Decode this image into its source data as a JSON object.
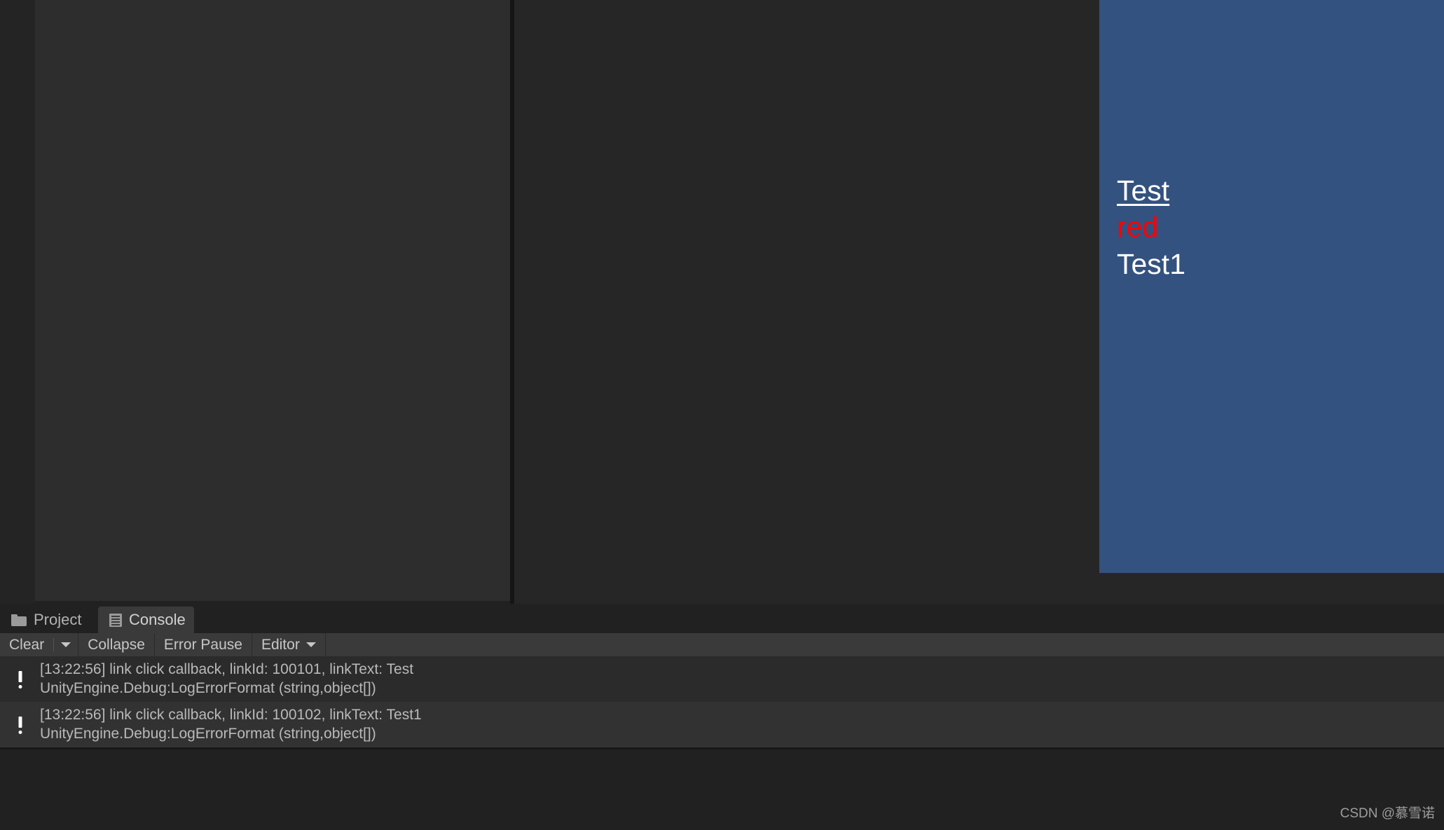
{
  "game_view": {
    "background_color": "#33527f",
    "lines": [
      {
        "text": "Test",
        "style": "link-underline",
        "color": "#ffffff"
      },
      {
        "text": "red",
        "style": "plain",
        "color": "#ff0000"
      },
      {
        "text": "Test1",
        "style": "plain",
        "color": "#ffffff"
      }
    ]
  },
  "dock": {
    "tabs": [
      {
        "label": "Project",
        "icon": "folder-icon",
        "active": false
      },
      {
        "label": "Console",
        "icon": "console-icon",
        "active": true
      }
    ]
  },
  "console": {
    "toolbar": {
      "clear_label": "Clear",
      "clear_dropdown_icon": "chevron-down-icon",
      "collapse_label": "Collapse",
      "error_pause_label": "Error Pause",
      "editor_label": "Editor",
      "editor_dropdown_icon": "chevron-down-icon"
    },
    "entries": [
      {
        "icon": "error-icon",
        "message": "[13:22:56] link click callback, linkId: 100101, linkText: Test",
        "stacktrace": "UnityEngine.Debug:LogErrorFormat (string,object[])"
      },
      {
        "icon": "error-icon",
        "message": "[13:22:56] link click callback, linkId: 100102, linkText: Test1",
        "stacktrace": "UnityEngine.Debug:LogErrorFormat (string,object[])"
      }
    ]
  },
  "watermark": {
    "text": "CSDN @慕雪诺"
  }
}
